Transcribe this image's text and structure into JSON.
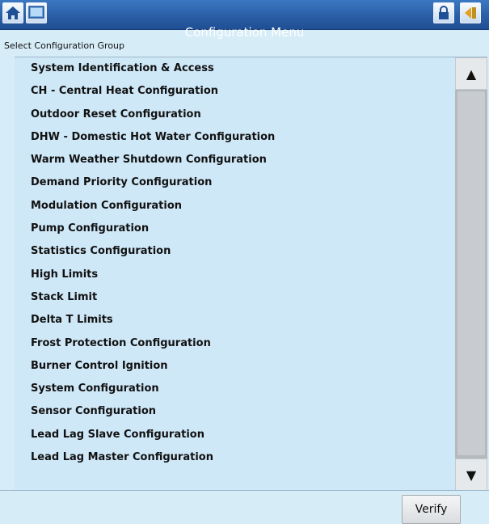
{
  "header": {
    "title": "Configuration Menu",
    "subtitle": "Select Configuration Group",
    "icons": [
      "home-icon",
      "screen-icon",
      "lock-icon",
      "back-icon"
    ]
  },
  "menu": {
    "items": [
      "System Identification & Access",
      "CH - Central Heat Configuration",
      "Outdoor Reset Configuration",
      "DHW - Domestic Hot Water Configuration",
      "Warm Weather Shutdown Configuration",
      "Demand Priority Configuration",
      "Modulation Configuration",
      "Pump Configuration",
      "Statistics Configuration",
      "High Limits",
      "Stack Limit",
      "Delta T Limits",
      "Frost Protection Configuration",
      "Burner Control Ignition",
      "System Configuration",
      "Sensor Configuration",
      "Lead Lag Slave Configuration",
      "Lead Lag Master Configuration"
    ]
  },
  "scrollbar": {
    "up": "▲",
    "down": "▼"
  },
  "footer": {
    "verify_label": "Verify"
  },
  "colors": {
    "titlebar": "#2a5ea6",
    "background": "#d6ecf7",
    "list_bg": "#cfe8f8"
  }
}
